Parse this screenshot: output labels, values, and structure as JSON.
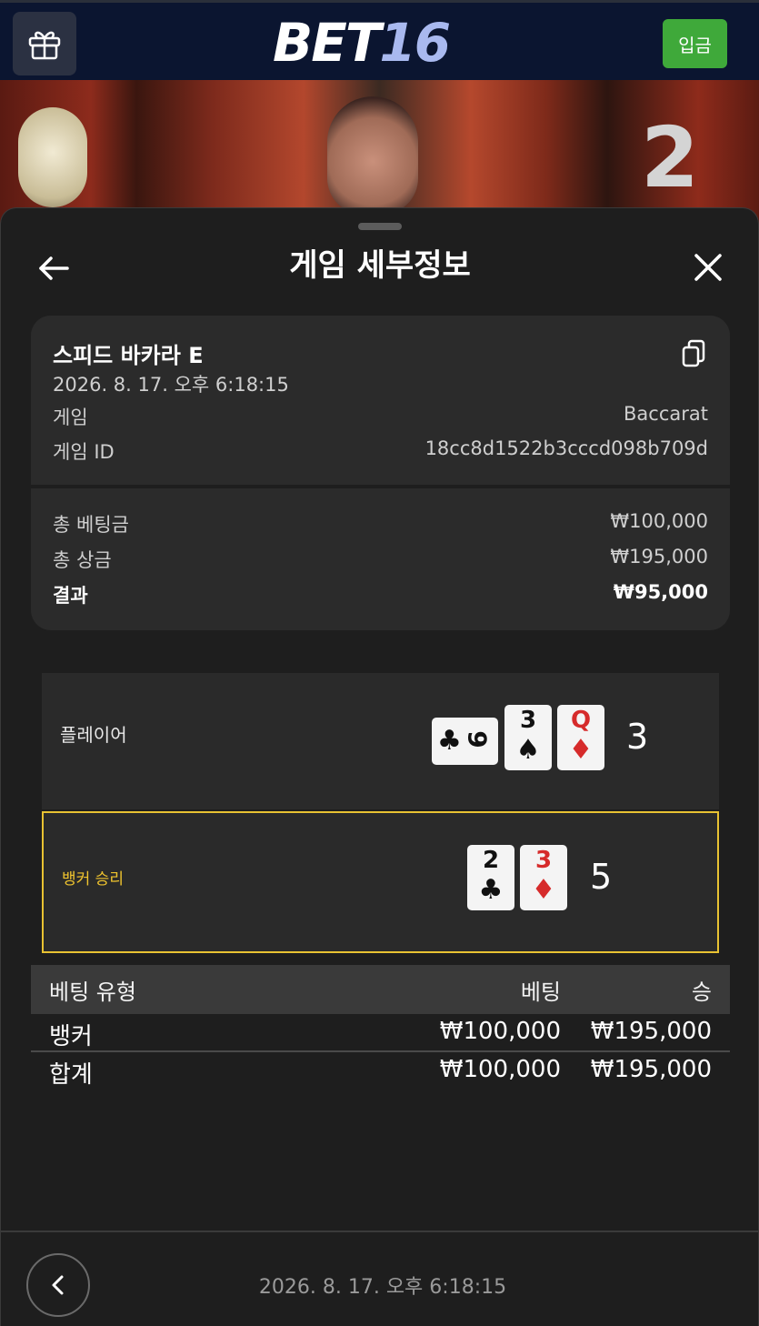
{
  "header": {
    "logo_part1": "BET",
    "logo_part2": "16",
    "deposit_label": "입금",
    "icons": {
      "gift": "gift-icon"
    }
  },
  "scene": {
    "table_number": "2"
  },
  "sheet": {
    "title": "게임 세부정보",
    "icons": {
      "back": "arrow-left-icon",
      "close": "close-icon",
      "copy": "copy-icon"
    }
  },
  "game_info": {
    "name": "스피드 바카라 E",
    "datetime": "2026. 8. 17. 오후 6:18:15",
    "game_label": "게임",
    "game_value": "Baccarat",
    "id_label": "게임 ID",
    "id_value": "18cc8d1522b3cccd098b709d",
    "total_bet_label": "총 베팅금",
    "total_bet_value": "₩100,000",
    "total_win_label": "총 상금",
    "total_win_value": "₩195,000",
    "result_label": "결과",
    "result_value": "₩95,000"
  },
  "result": {
    "player": {
      "label": "플레이어",
      "score": "3",
      "cards": [
        {
          "rank": "9",
          "suit": "♣",
          "color": "black",
          "sideways": true
        },
        {
          "rank": "3",
          "suit": "♠",
          "color": "black",
          "sideways": false
        },
        {
          "rank": "Q",
          "suit": "♦",
          "color": "red",
          "sideways": false
        }
      ]
    },
    "banker": {
      "label": "뱅커 승리",
      "score": "5",
      "cards": [
        {
          "rank": "2",
          "suit": "♣",
          "color": "black"
        },
        {
          "rank": "3",
          "suit": "♦",
          "color": "red"
        }
      ]
    },
    "highlight_color": "#e8c232"
  },
  "bets": {
    "headers": [
      "베팅 유형",
      "베팅",
      "승"
    ],
    "rows": [
      {
        "type": "뱅커",
        "bet": "₩100,000",
        "win": "₩195,000"
      }
    ],
    "total": {
      "type": "합계",
      "bet": "₩100,000",
      "win": "₩195,000"
    }
  },
  "footer": {
    "datetime": "2026. 8. 17. 오후 6:18:15",
    "icons": {
      "prev": "chevron-left-icon"
    }
  },
  "colors": {
    "accent_green": "#3fa93a",
    "header_bg": "#0b1530",
    "banker_gold": "#e8c232"
  }
}
